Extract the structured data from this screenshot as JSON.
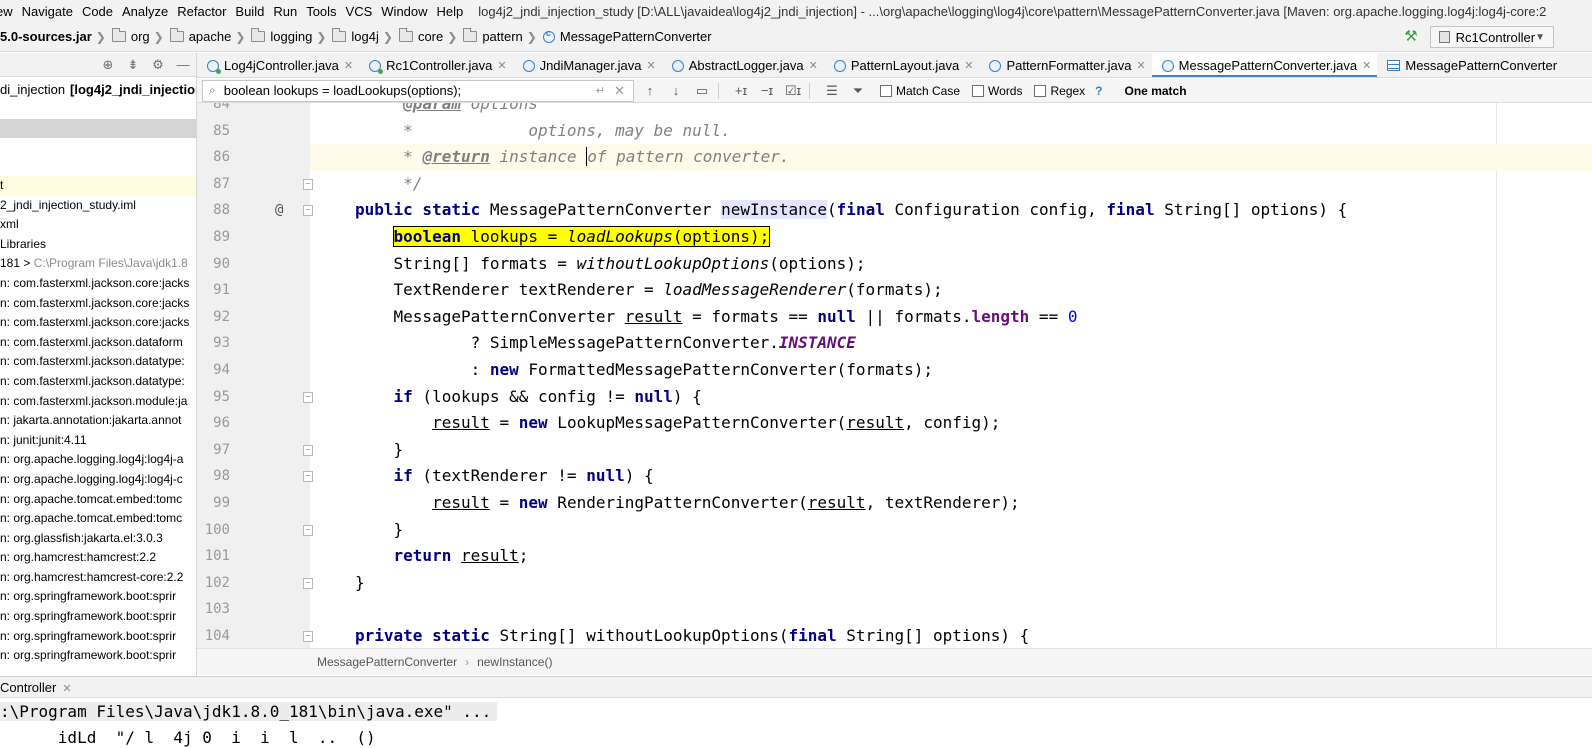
{
  "menu": {
    "items": [
      "ew",
      "Navigate",
      "Code",
      "Analyze",
      "Refactor",
      "Build",
      "Run",
      "Tools",
      "VCS",
      "Window",
      "Help"
    ],
    "window_title": "log4j2_jndi_injection_study [D:\\ALL\\javaidea\\log4j2_jndi_injection] - ...\\org\\apache\\logging\\log4j\\core\\pattern\\MessagePatternConverter.java [Maven: org.apache.logging.log4j:log4j-core:2"
  },
  "breadcrumb": {
    "jar": "5.0-sources.jar",
    "folders": [
      "org",
      "apache",
      "logging",
      "log4j",
      "core",
      "pattern"
    ],
    "class": "MessagePatternConverter"
  },
  "run_config": {
    "label": "Rc1Controller"
  },
  "project": {
    "root_name": "di_injection",
    "root_bold": "[log4j2_jndi_injection",
    "rows": [
      {
        "text": "t",
        "gray": "",
        "highlight": true
      },
      {
        "text": "2_jndi_injection_study.iml",
        "gray": "",
        "highlight": false
      },
      {
        "text": "xml",
        "gray": "",
        "highlight": false
      },
      {
        "text": "Libraries",
        "gray": "",
        "highlight": false
      },
      {
        "text": "181 > ",
        "gray": "C:\\Program Files\\Java\\jdk1.8",
        "highlight": false
      },
      {
        "text": "n: com.fasterxml.jackson.core:jacks",
        "gray": "",
        "highlight": false
      },
      {
        "text": "n: com.fasterxml.jackson.core:jacks",
        "gray": "",
        "highlight": false
      },
      {
        "text": "n: com.fasterxml.jackson.core:jacks",
        "gray": "",
        "highlight": false
      },
      {
        "text": "n: com.fasterxml.jackson.dataform",
        "gray": "",
        "highlight": false
      },
      {
        "text": "n: com.fasterxml.jackson.datatype:",
        "gray": "",
        "highlight": false
      },
      {
        "text": "n: com.fasterxml.jackson.datatype:",
        "gray": "",
        "highlight": false
      },
      {
        "text": "n: com.fasterxml.jackson.module:ja",
        "gray": "",
        "highlight": false
      },
      {
        "text": "n: jakarta.annotation:jakarta.annot",
        "gray": "",
        "highlight": false
      },
      {
        "text": "n: junit:junit:4.11",
        "gray": "",
        "highlight": false
      },
      {
        "text": "n: org.apache.logging.log4j:log4j-a",
        "gray": "",
        "highlight": false
      },
      {
        "text": "n: org.apache.logging.log4j:log4j-c",
        "gray": "",
        "highlight": false
      },
      {
        "text": "n: org.apache.tomcat.embed:tomc",
        "gray": "",
        "highlight": false
      },
      {
        "text": "n: org.apache.tomcat.embed:tomc",
        "gray": "",
        "highlight": false
      },
      {
        "text": "n: org.glassfish:jakarta.el:3.0.3",
        "gray": "",
        "highlight": false
      },
      {
        "text": "n: org.hamcrest:hamcrest:2.2",
        "gray": "",
        "highlight": false
      },
      {
        "text": "n: org.hamcrest:hamcrest-core:2.2",
        "gray": "",
        "highlight": false
      },
      {
        "text": "n: org.springframework.boot:sprir",
        "gray": "",
        "highlight": false
      },
      {
        "text": "n: org.springframework.boot:sprir",
        "gray": "",
        "highlight": false
      },
      {
        "text": "n: org.springframework.boot:sprir",
        "gray": "",
        "highlight": false
      },
      {
        "text": "n: org.springframework.boot:sprir",
        "gray": "",
        "highlight": false
      }
    ]
  },
  "tabs": [
    {
      "label": "Log4jController.java",
      "icon": "class-icon-green",
      "active": false
    },
    {
      "label": "Rc1Controller.java",
      "icon": "class-icon-green",
      "active": false
    },
    {
      "label": "JndiManager.java",
      "icon": "class-icon",
      "active": false
    },
    {
      "label": "AbstractLogger.java",
      "icon": "class-icon",
      "active": false
    },
    {
      "label": "PatternLayout.java",
      "icon": "class-icon",
      "active": false
    },
    {
      "label": "PatternFormatter.java",
      "icon": "class-icon",
      "active": false
    },
    {
      "label": "MessagePatternConverter.java",
      "icon": "class-icon",
      "active": true
    },
    {
      "label": "MessagePatternConverter",
      "icon": "structure-icon",
      "active": false
    }
  ],
  "search": {
    "query": "boolean lookups = loadLookups(options);",
    "match_case": "Match Case",
    "words": "Words",
    "regex": "Regex",
    "help": "?",
    "result": "One match"
  },
  "editor": {
    "lines": [
      {
        "n": "84",
        "html": "     <span class=\"tag\">@param</span><span class=\"cm\"> options</span>"
      },
      {
        "n": "85",
        "html": "     <span class=\"cm\">*            options, may be null.</span>"
      },
      {
        "n": "86",
        "html": "     <span class=\"cm\">* </span><span class=\"tag\">@return</span><span class=\"cm\"> instance <span class=\"cursor\">o</span>f pattern converter.</span>"
      },
      {
        "n": "87",
        "html": "     <span class=\"cm\">*/</span>"
      },
      {
        "n": "88",
        "html": "<span class=\"kw\">public static</span> MessagePatternConverter <span class=\"decl\">newInstance</span>(<span class=\"kw\">final</span> Configuration config, <span class=\"kw\">final</span> String[] options) {"
      },
      {
        "n": "89",
        "html": "    <span class=\"found\"><span class=\"kw\">boolean</span> lookups = <span class=\"smc\">loadLookups</span>(options);</span>"
      },
      {
        "n": "90",
        "html": "    String[] formats = <span class=\"smc\">withoutLookupOptions</span>(options);"
      },
      {
        "n": "91",
        "html": "    TextRenderer textRenderer = <span class=\"smc\">loadMessageRenderer</span>(formats);"
      },
      {
        "n": "92",
        "html": "    MessagePatternConverter <span class=\"ul\">result</span> = formats == <span class=\"kw\">null</span> || formats.<span class=\"fld\">length</span> == <span class=\"num\">0</span>"
      },
      {
        "n": "93",
        "html": "            ? SimpleMessagePatternConverter.<span class=\"sf\">INSTANCE</span>"
      },
      {
        "n": "94",
        "html": "            : <span class=\"kw\">new</span> FormattedMessagePatternConverter(formats);"
      },
      {
        "n": "95",
        "html": "    <span class=\"kw\">if</span> (lookups &amp;&amp; config != <span class=\"kw\">null</span>) {"
      },
      {
        "n": "96",
        "html": "        <span class=\"ul\">result</span> = <span class=\"kw\">new</span> LookupMessagePatternConverter(<span class=\"ul\">result</span>, config);"
      },
      {
        "n": "97",
        "html": "    }"
      },
      {
        "n": "98",
        "html": "    <span class=\"kw\">if</span> (textRenderer != <span class=\"kw\">null</span>) {"
      },
      {
        "n": "99",
        "html": "        <span class=\"ul\">result</span> = <span class=\"kw\">new</span> RenderingPatternConverter(<span class=\"ul\">result</span>, textRenderer);"
      },
      {
        "n": "100",
        "html": "    }"
      },
      {
        "n": "101",
        "html": "    <span class=\"kw\">return</span> <span class=\"ul\">result</span>;"
      },
      {
        "n": "102",
        "html": "}"
      },
      {
        "n": "103",
        "html": ""
      },
      {
        "n": "104",
        "html": "<span class=\"kw\">private static</span> String[] withoutLookupOptions(<span class=\"kw\">final</span> String[] options) {"
      }
    ],
    "crumbs": [
      "MessagePatternConverter",
      "newInstance()"
    ]
  },
  "run_panel": {
    "tab_label": "Controller",
    "console_lines": [
      ":\\Program Files\\Java\\jdk1.8.0_181\\bin\\java.exe\" ...",
      "      idLd  \"/ l  4j 0  i  i  l  ..  ()"
    ]
  }
}
